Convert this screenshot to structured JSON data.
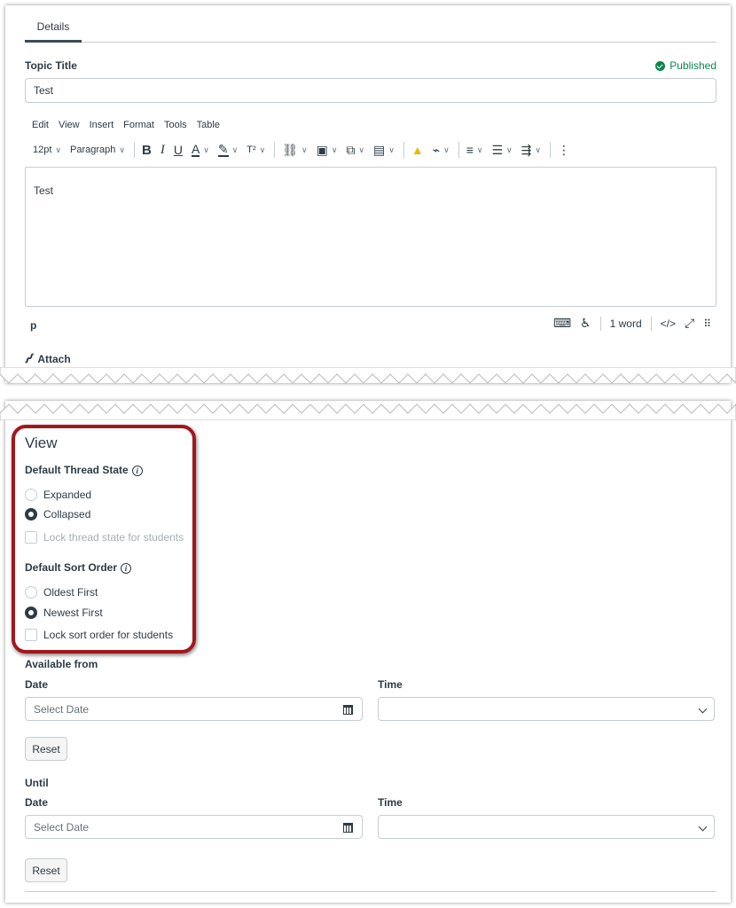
{
  "tabs": [
    {
      "label": "Details"
    }
  ],
  "topic": {
    "title_label": "Topic Title",
    "title_value": "Test",
    "status": "Published"
  },
  "editor": {
    "menu": [
      "Edit",
      "View",
      "Insert",
      "Format",
      "Tools",
      "Table"
    ],
    "font_size": "12pt",
    "block_format": "Paragraph",
    "superscript_label": "T²",
    "content": "Test",
    "path": "p",
    "word_count": "1 word",
    "html_toggle": "</>",
    "more": "⋮",
    "resize": "⠿"
  },
  "attach": {
    "label": "Attach"
  },
  "view": {
    "title": "View",
    "thread_state": {
      "label": "Default Thread State",
      "options": [
        "Expanded",
        "Collapsed"
      ],
      "selected": "Collapsed",
      "lock_label": "Lock thread state for students"
    },
    "sort_order": {
      "label": "Default Sort Order",
      "options": [
        "Oldest First",
        "Newest First"
      ],
      "selected": "Newest First",
      "lock_label": "Lock sort order for students"
    }
  },
  "available_from": {
    "label": "Available from",
    "date_label": "Date",
    "time_label": "Time",
    "date_placeholder": "Select Date",
    "reset": "Reset"
  },
  "until": {
    "label": "Until",
    "date_label": "Date",
    "time_label": "Time",
    "date_placeholder": "Select Date",
    "reset": "Reset"
  },
  "colors": {
    "accent": "#394b58",
    "published": "#0b874b",
    "highlight": "#a1171d"
  }
}
